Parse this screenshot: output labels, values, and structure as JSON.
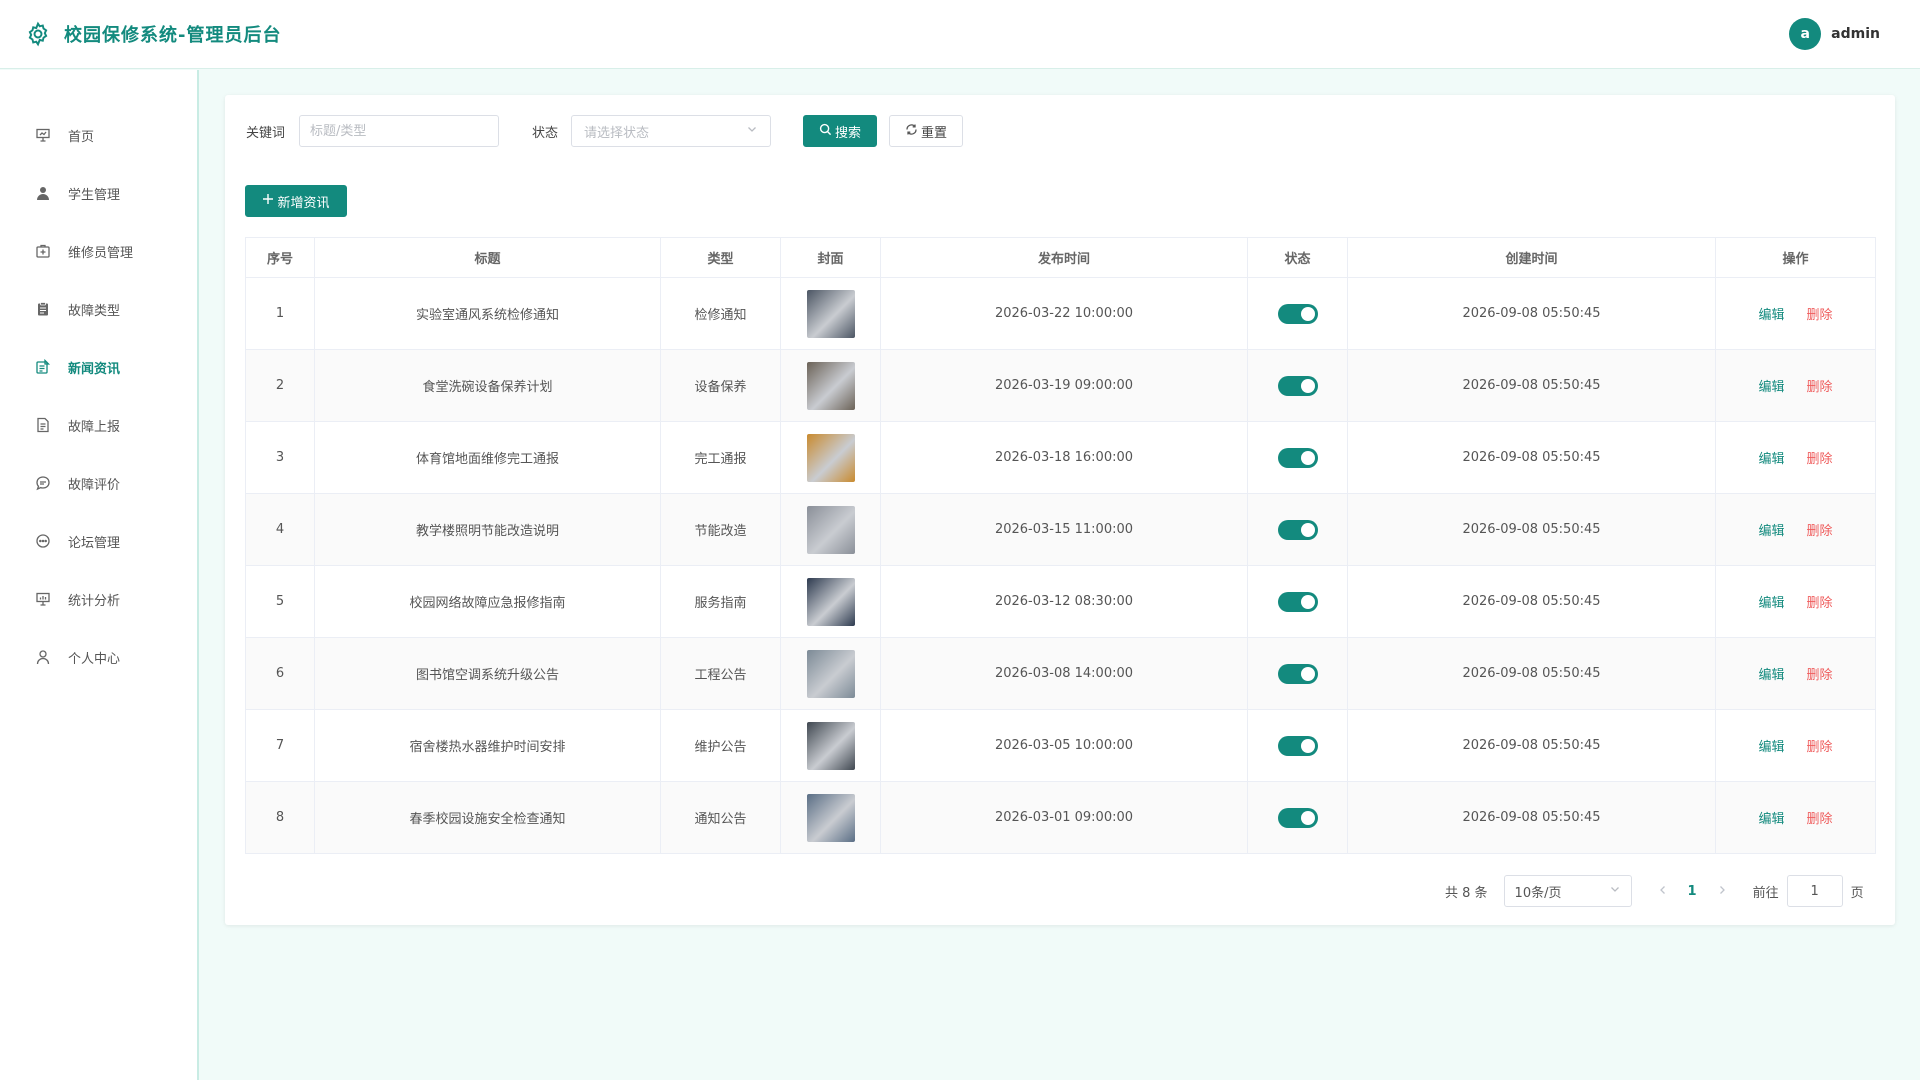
{
  "app": {
    "title": "校园保修系统-管理员后台"
  },
  "user": {
    "avatar_letter": "a",
    "name": "admin"
  },
  "sidebar": {
    "items": [
      {
        "label": "首页",
        "icon": "presentation-icon"
      },
      {
        "label": "学生管理",
        "icon": "user-icon"
      },
      {
        "label": "维修员管理",
        "icon": "medical-box-icon"
      },
      {
        "label": "故障类型",
        "icon": "clipboard-icon"
      },
      {
        "label": "新闻资讯",
        "icon": "news-icon",
        "active": true
      },
      {
        "label": "故障上报",
        "icon": "document-icon"
      },
      {
        "label": "故障评价",
        "icon": "comment-icon"
      },
      {
        "label": "论坛管理",
        "icon": "chat-icon"
      },
      {
        "label": "统计分析",
        "icon": "chart-icon"
      },
      {
        "label": "个人中心",
        "icon": "person-icon"
      }
    ]
  },
  "filters": {
    "keyword_label": "关键词",
    "keyword_placeholder": "标题/类型",
    "keyword_value": "",
    "status_label": "状态",
    "status_placeholder": "请选择状态",
    "search_label": "搜索",
    "reset_label": "重置"
  },
  "toolbar": {
    "add_label": "新增资讯"
  },
  "table": {
    "columns": [
      "序号",
      "标题",
      "类型",
      "封面",
      "发布时间",
      "状态",
      "创建时间",
      "操作"
    ],
    "edit_label": "编辑",
    "delete_label": "删除",
    "rows": [
      {
        "index": "1",
        "title": "实验室通风系统检修通知",
        "type": "检修通知",
        "publish_time": "2026-03-22 10:00:00",
        "status_on": true,
        "created": "2026-09-08 05:50:45",
        "cover_color": "#4b5563"
      },
      {
        "index": "2",
        "title": "食堂洗碗设备保养计划",
        "type": "设备保养",
        "publish_time": "2026-03-19 09:00:00",
        "status_on": true,
        "created": "2026-09-08 05:50:45",
        "cover_color": "#6b6257"
      },
      {
        "index": "3",
        "title": "体育馆地面维修完工通报",
        "type": "完工通报",
        "publish_time": "2026-03-18 16:00:00",
        "status_on": true,
        "created": "2026-09-08 05:50:45",
        "cover_color": "#c98a2e"
      },
      {
        "index": "4",
        "title": "教学楼照明节能改造说明",
        "type": "节能改造",
        "publish_time": "2026-03-15 11:00:00",
        "status_on": true,
        "created": "2026-09-08 05:50:45",
        "cover_color": "#8a8f98"
      },
      {
        "index": "5",
        "title": "校园网络故障应急报修指南",
        "type": "服务指南",
        "publish_time": "2026-03-12 08:30:00",
        "status_on": true,
        "created": "2026-09-08 05:50:45",
        "cover_color": "#2d3a4f"
      },
      {
        "index": "6",
        "title": "图书馆空调系统升级公告",
        "type": "工程公告",
        "publish_time": "2026-03-08 14:00:00",
        "status_on": true,
        "created": "2026-09-08 05:50:45",
        "cover_color": "#7c8a96"
      },
      {
        "index": "7",
        "title": "宿舍楼热水器维护时间安排",
        "type": "维护公告",
        "publish_time": "2026-03-05 10:00:00",
        "status_on": true,
        "created": "2026-09-08 05:50:45",
        "cover_color": "#3f4750"
      },
      {
        "index": "8",
        "title": "春季校园设施安全检查通知",
        "type": "通知公告",
        "publish_time": "2026-03-01 09:00:00",
        "status_on": true,
        "created": "2026-09-08 05:50:45",
        "cover_color": "#5a6e85"
      }
    ]
  },
  "pagination": {
    "total_text": "共 8 条",
    "page_size": "10条/页",
    "current_page": "1",
    "goto_label": "前往",
    "goto_value": "1",
    "page_suffix": "页"
  },
  "colors": {
    "accent": "#138a7e",
    "danger": "#ef5b5b"
  }
}
